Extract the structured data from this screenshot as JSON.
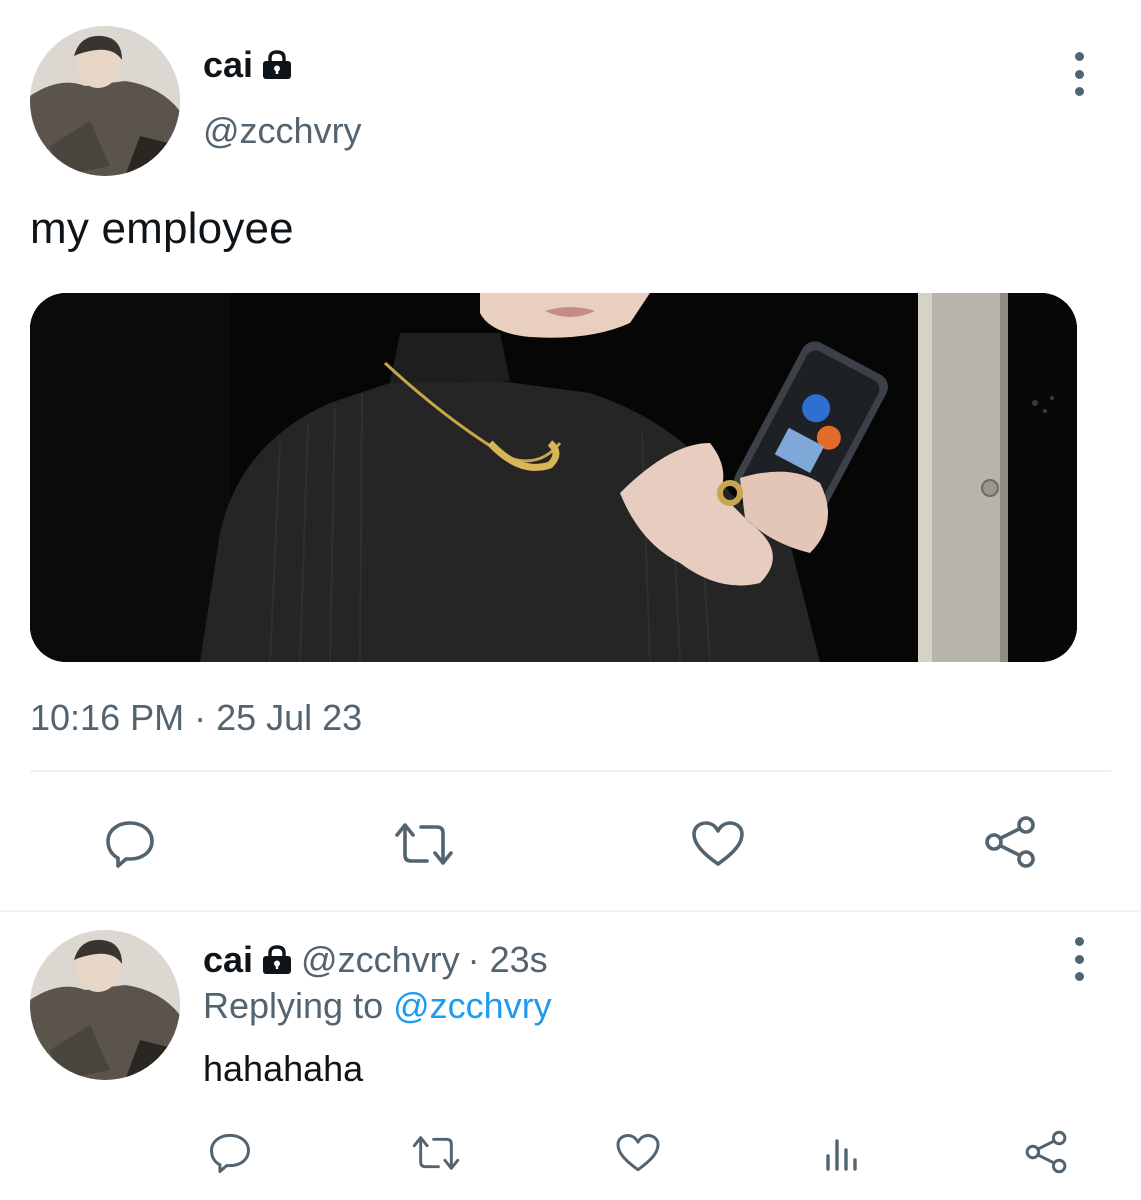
{
  "tweet": {
    "author": {
      "display_name": "cai",
      "handle": "@zcchvry",
      "protected_icon": "lock-icon",
      "avatar": "avatar"
    },
    "more_icon": "more-vertical-icon",
    "text": "my employee",
    "media": {
      "alt": "photo"
    },
    "timestamp": "10:16 PM · 25 Jul 23",
    "actions": [
      {
        "name": "reply",
        "icon": "reply-icon"
      },
      {
        "name": "retweet",
        "icon": "retweet-icon"
      },
      {
        "name": "like",
        "icon": "heart-icon"
      },
      {
        "name": "share",
        "icon": "share-icon"
      }
    ]
  },
  "reply": {
    "author": {
      "display_name": "cai",
      "handle": "@zcchvry",
      "time": "· 23s",
      "protected_icon": "lock-icon"
    },
    "replying_label": "Replying to",
    "replying_handle": "@zcchvry",
    "text": "hahahaha",
    "actions": [
      {
        "name": "reply",
        "icon": "reply-icon"
      },
      {
        "name": "retweet",
        "icon": "retweet-icon"
      },
      {
        "name": "like",
        "icon": "heart-icon"
      },
      {
        "name": "views",
        "icon": "analytics-icon"
      },
      {
        "name": "share",
        "icon": "share-icon"
      }
    ]
  },
  "colors": {
    "text_primary": "#0f1419",
    "text_secondary": "#536471",
    "link": "#1d9bf0",
    "divider": "#eff3f4"
  }
}
